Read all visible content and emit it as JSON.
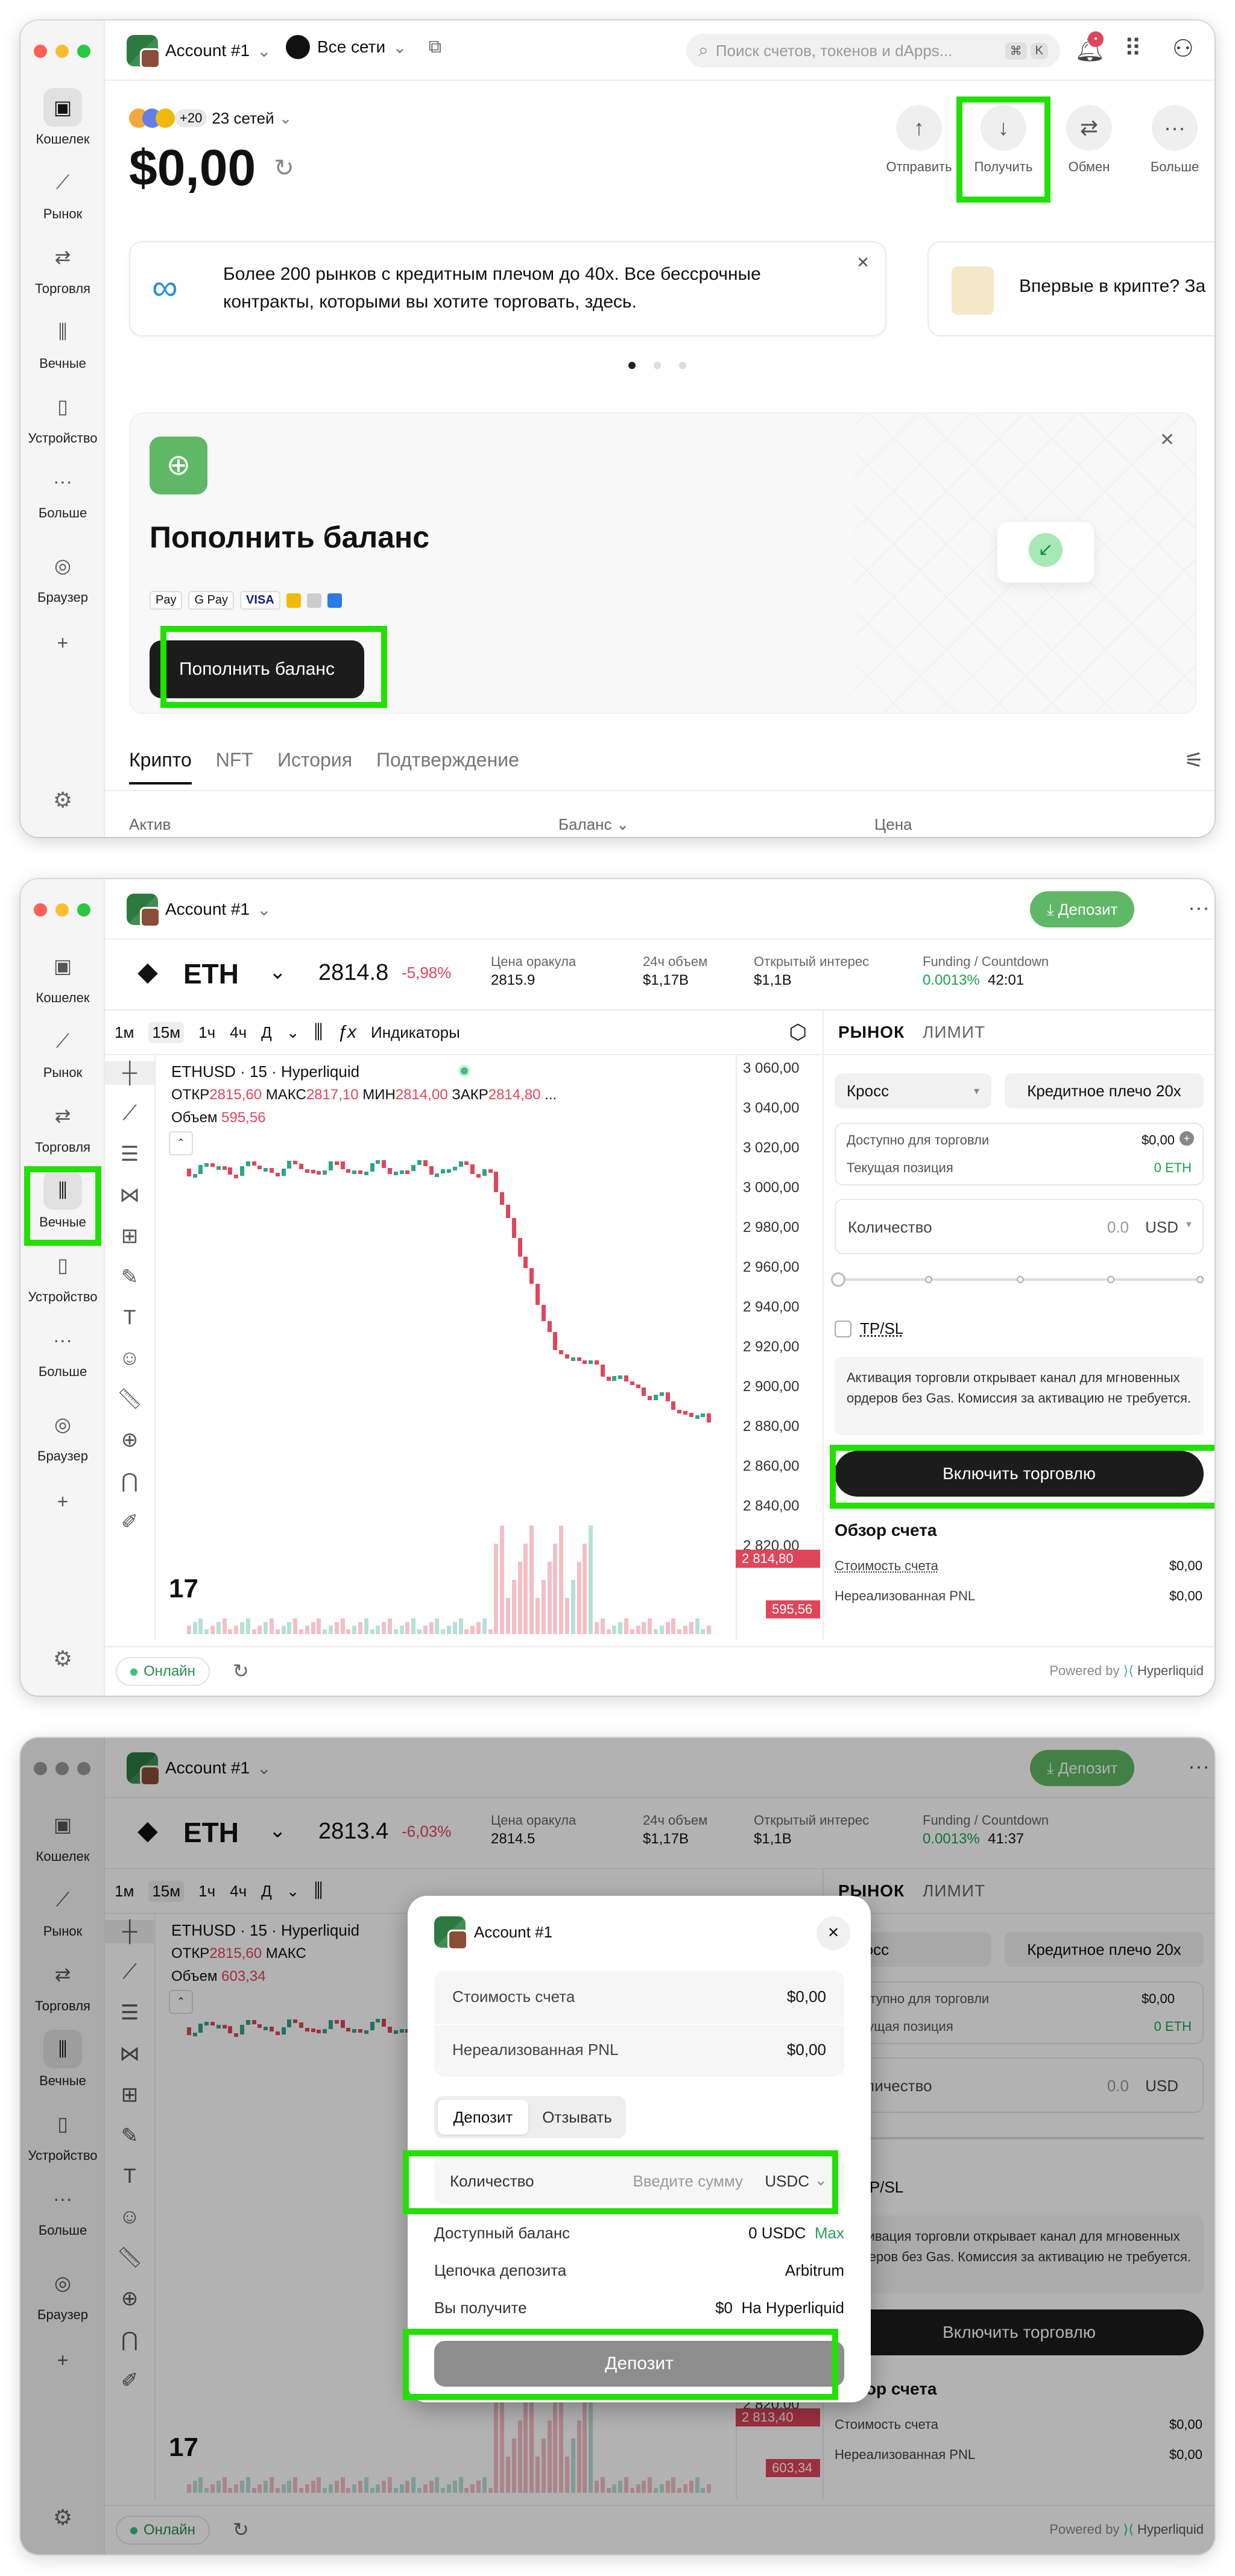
{
  "common": {
    "account_name": "Account #1",
    "sidebar": {
      "wallet": "Кошелек",
      "market": "Рынок",
      "trade": "Торговля",
      "perps": "Вечные",
      "device": "Устройство",
      "more": "Больше",
      "browser": "Браузер"
    }
  },
  "w1": {
    "networks_btn": "Все сети",
    "search_placeholder": "Поиск счетов, токенов и dApps...",
    "search_shortcut_k": "K",
    "notif_count": "•",
    "chain_more": "+20",
    "chain_count": "23 сетей",
    "balance": "$0,00",
    "actions": {
      "send": "Отправить",
      "receive": "Получить",
      "swap": "Обмен",
      "more": "Больше"
    },
    "promo": "Более 200 рынков с кредитным плечом до 40x. Все бессрочные контракты, которыми вы хотите торговать, здесь.",
    "promo2": "Впервые в крипте? За",
    "deposit_title": "Пополнить баланс",
    "pay_methods": [
      "Pay",
      "G Pay",
      "VISA"
    ],
    "deposit_btn": "Пополнить баланс",
    "tabs": [
      "Крипто",
      "NFT",
      "История",
      "Подтверждение"
    ],
    "table_headers": [
      "Актив",
      "Баланс",
      "Цена"
    ]
  },
  "trade": {
    "deposit_btn": "Депозит",
    "symbol": "ETH",
    "price_w2": "2814.8",
    "change_w2": "-5,98%",
    "price_w3": "2813.4",
    "change_w3": "-6,03%",
    "stats_labels": [
      "Цена оракула",
      "24ч объем",
      "Открытый интерес",
      "Funding / Countdown"
    ],
    "oracle_w2": "2815.9",
    "oracle_w3": "2814.5",
    "volume": "$1,17B",
    "oi": "$1,1B",
    "funding": "0.0013%",
    "countdown_w2": "42:01",
    "countdown_w3": "41:37",
    "timeframes": [
      "1м",
      "15м",
      "1ч",
      "4ч",
      "Д"
    ],
    "indicators": "Индикаторы",
    "chart_title": "ETHUSD · 15 · Hyperliquid",
    "ohlc_labels": [
      "ОТКР",
      "МАКС",
      "МИН",
      "ЗАКР"
    ],
    "ohlc_w2": [
      "2815,60",
      "2817,10",
      "2814,00",
      "2814,80"
    ],
    "ohlc_w3_short": [
      "2815,60"
    ],
    "vol_label": "Объем",
    "vol_w2": "595,56",
    "vol_w3": "603,34",
    "price_axis": [
      "3 060,00",
      "3 040,00",
      "3 020,00",
      "3 000,00",
      "2 980,00",
      "2 960,00",
      "2 940,00",
      "2 920,00",
      "2 900,00",
      "2 880,00",
      "2 860,00",
      "2 840,00",
      "2 820,00"
    ],
    "last_price_tag_w2": "2 814,80",
    "last_price_tag_w3": "2 813,40",
    "vol_tag_w2": "595,56",
    "vol_tag_w3": "603,34",
    "order_tabs": [
      "РЫНОК",
      "ЛИМИТ"
    ],
    "margin_mode": "Кросс",
    "leverage": "Кредитное плечо 20x",
    "available_label": "Доступно для торговли",
    "available_val": "$0,00",
    "position_label": "Текущая позиция",
    "position_val": "0 ETH",
    "qty_label": "Количество",
    "qty_val": "0.0",
    "qty_unit": "USD",
    "tpsl": "TP/SL",
    "activation_text": "Активация торговли открывает канал для мгновенных ордеров без Gas. Комиссия за активацию не требуется.",
    "enable_btn": "Включить торговлю",
    "overview_title": "Обзор счета",
    "overview_rows": [
      {
        "label": "Стоимость счета",
        "value": "$0,00"
      },
      {
        "label": "Нереализованная PNL",
        "value": "$0,00"
      }
    ],
    "online": "Онлайн",
    "powered": "Powered by",
    "powered_brand": "Hyperliquid"
  },
  "modal": {
    "title": "Account #1",
    "account_value_label": "Стоимость счета",
    "account_value": "$0,00",
    "pnl_label": "Нереализованная PNL",
    "pnl_value": "$0,00",
    "seg_deposit": "Депозит",
    "seg_withdraw": "Отзывать",
    "qty_label": "Количество",
    "qty_placeholder": "Введите сумму",
    "qty_unit": "USDC",
    "available_label": "Доступный баланс",
    "available_value": "0 USDC",
    "max": "Max",
    "chain_label": "Цепочка депозита",
    "chain_value": "Arbitrum",
    "receive_label": "Вы получите",
    "receive_value": "$0",
    "receive_dest": "На Hyperliquid",
    "submit": "Депозит"
  }
}
